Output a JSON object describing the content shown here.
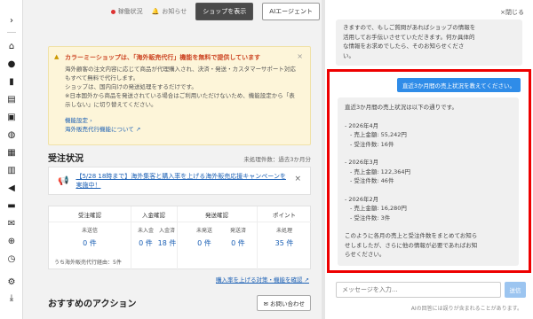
{
  "topbar": {
    "status_label": "稼働状況",
    "notice_label": "お知らせ",
    "shop_button": "ショップを表示",
    "ai_button": "AIエージェント"
  },
  "notice": {
    "title": "カラーミーショップは、「海外販売代行」機能を無料で提供しています",
    "lines": [
      "海外顧客の注文内容に応じて商品が代理購入され、決済・発送・カスタマーサポート対応",
      "もすべて無料で代行します。",
      "ショップは、国内向けの発送処理をするだけです。",
      "※日本国外から商品を発送されている場合はご利用いただけないため、機能設定から「表",
      "示しない」に切り替えてください。"
    ],
    "link1": "機能設定 ›",
    "link2": "海外販売代行機能について"
  },
  "orders": {
    "title": "受注状況",
    "unprocessed": "未処理件数：過去3か月分",
    "campaign": "【5/28 18時まで】海外集客と購入率を上げる海外販売応援キャンペーンを実施中！",
    "headers": [
      "受注確認",
      "入金確認",
      "発送確認",
      "ポイント"
    ],
    "cells": [
      {
        "label": "未送信",
        "value": "0 件"
      },
      {
        "label": "未入金",
        "value": "0 件"
      },
      {
        "label": "入金済",
        "value": "18 件"
      },
      {
        "label": "未発送",
        "value": "0 件"
      },
      {
        "label": "発送済",
        "value": "0 件"
      },
      {
        "label": "未処理",
        "value": "35 件"
      }
    ],
    "sub_note": "うち海外販売代行経由：5件",
    "footer_link": "購入率を上げる対策・機能を確認"
  },
  "actions": {
    "title": "おすすめのアクション",
    "inquiry_button": "お問い合わせ"
  },
  "chat": {
    "close_label": "×閉じる",
    "prev_lines": [
      "きますので、もしご質問があればショップの情報を",
      "活用してお手伝いさせていただきます。何か具体的",
      "な情報をお求めでしたら、そのお知らせくださ",
      "い。"
    ],
    "user_message": "直近3か月間の売上状況を教えてください。",
    "answer": {
      "intro": "直近3か月間の売上状況は以下の通りです。",
      "months": [
        {
          "month": "- 2026年4月",
          "sales": "- 売上金額: 55,242円",
          "orders": "- 受注件数: 16件"
        },
        {
          "month": "- 2026年3月",
          "sales": "- 売上金額: 122,364円",
          "orders": "- 受注件数: 46件"
        },
        {
          "month": "- 2026年2月",
          "sales": "- 売上金額: 16,280円",
          "orders": "- 受注件数: 3件"
        }
      ],
      "outro": [
        "このように各月の売上と受注件数をまとめてお知ら",
        "せしましたが、さらに他の情報が必要であればお知",
        "らせください。"
      ]
    },
    "input_placeholder": "メッセージを入力...",
    "send_label": "送信",
    "disclaimer": "AIの回答には誤りが含まれることがあります。"
  }
}
